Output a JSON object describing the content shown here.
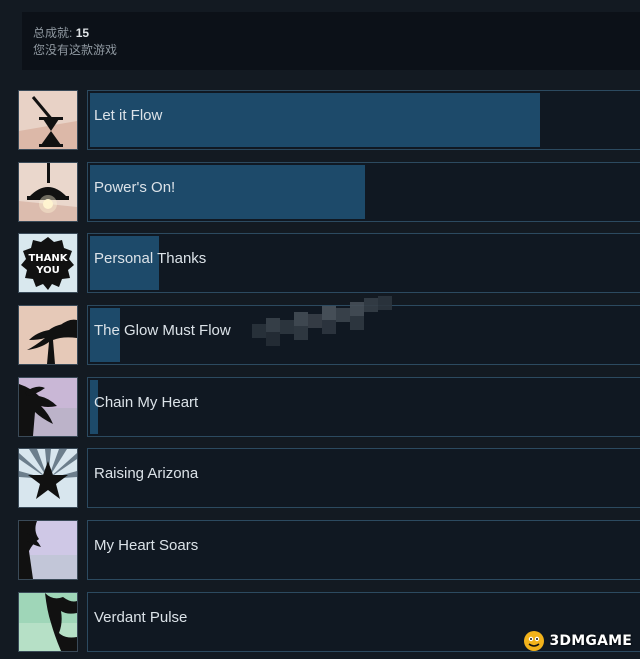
{
  "summary": {
    "total_label": "总成就:",
    "total_count": "15",
    "status": "您没有这款游戏"
  },
  "achievements": [
    {
      "name": "Let it Flow",
      "progress": 0.82,
      "icon": "hourglass-icon"
    },
    {
      "name": "Power's On!",
      "progress": 0.5,
      "icon": "ceiling-lamp-icon"
    },
    {
      "name": "Personal Thanks",
      "progress": 0.125,
      "icon": "thank-you-badge-icon"
    },
    {
      "name": "The Glow Must Flow",
      "progress": 0.055,
      "icon": "tree-silhouette-icon"
    },
    {
      "name": "Chain My Heart",
      "progress": 0.014,
      "icon": "tree-branch-icon"
    },
    {
      "name": "Raising Arizona",
      "progress": 0,
      "icon": "star-burst-icon"
    },
    {
      "name": "My Heart Soars",
      "progress": 0,
      "icon": "tree-silhouette-icon"
    },
    {
      "name": "Verdant Pulse",
      "progress": 0,
      "icon": "tree-silhouette-icon"
    }
  ],
  "watermark": {
    "text": "3DMGAME",
    "icon": "3dm-logo-icon"
  },
  "colors": {
    "background": "#131a22",
    "summary_bg": "#0c1118",
    "progress_fill": "#1d4a6a",
    "row_border": "#2c4a60"
  }
}
